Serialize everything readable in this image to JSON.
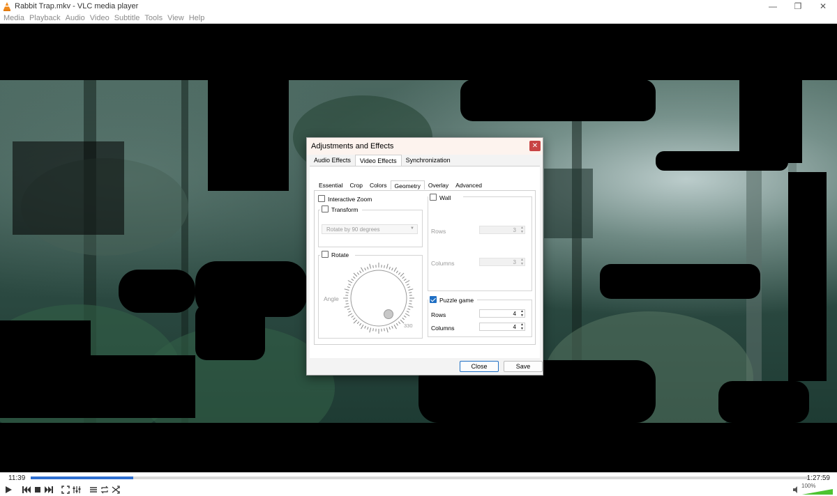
{
  "window": {
    "title": "Rabbit Trap.mkv - VLC media player",
    "minimize": "—",
    "maximize": "❐",
    "close": "✕"
  },
  "menu": [
    "Media",
    "Playback",
    "Audio",
    "Video",
    "Subtitle",
    "Tools",
    "View",
    "Help"
  ],
  "player": {
    "elapsed": "11:39",
    "total": "1:27:59",
    "progress_fraction": 0.132,
    "volume_label": "100%",
    "volume_fraction": 1.0
  },
  "dialog": {
    "title": "Adjustments and Effects",
    "close_glyph": "✕",
    "tabs": [
      "Audio Effects",
      "Video Effects",
      "Synchronization"
    ],
    "active_tab": "Video Effects",
    "subtabs": [
      "Essential",
      "Crop",
      "Colors",
      "Geometry",
      "Overlay",
      "Advanced"
    ],
    "active_subtab": "Geometry",
    "geometry": {
      "interactive_zoom": {
        "label": "Interactive Zoom",
        "checked": false
      },
      "transform": {
        "label": "Transform",
        "checked": false,
        "option": "Rotate by 90 degrees"
      },
      "rotate": {
        "label": "Rotate",
        "checked": false,
        "angle_label": "Angle",
        "angle_value": "330"
      },
      "wall": {
        "label": "Wall",
        "checked": false,
        "rows_label": "Rows",
        "rows_value": "3",
        "columns_label": "Columns",
        "columns_value": "3"
      },
      "puzzle": {
        "label": "Puzzle game",
        "checked": true,
        "rows_label": "Rows",
        "rows_value": "4",
        "columns_label": "Columns",
        "columns_value": "4"
      }
    },
    "buttons": {
      "close": "Close",
      "save": "Save"
    }
  },
  "colors": {
    "accent": "#1f6fc4",
    "seek_fill": "#2f6fd0",
    "close_red": "#c84444",
    "volume_green": "#4cc431"
  },
  "icons": {
    "app": "vlc-cone-icon",
    "play": "play-icon",
    "prev": "previous-icon",
    "stop": "stop-icon",
    "next": "next-icon",
    "fullscreen": "fullscreen-icon",
    "extended": "extended-settings-icon",
    "playlist": "playlist-icon",
    "loop": "loop-icon",
    "random": "shuffle-icon",
    "mute": "speaker-icon"
  }
}
